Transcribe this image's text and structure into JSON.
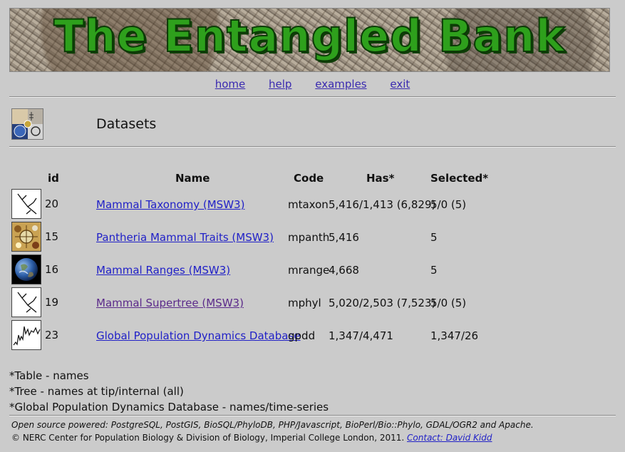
{
  "banner": {
    "title": "The Entangled Bank"
  },
  "nav": [
    "home",
    "help",
    "examples",
    "exit"
  ],
  "page": {
    "title": "Datasets"
  },
  "table": {
    "headers": {
      "id": "id",
      "name": "Name",
      "code": "Code",
      "has": "Has*",
      "selected": "Selected*"
    },
    "rows": [
      {
        "id": "20",
        "name": "Mammal Taxonomy (MSW3)",
        "code": "mtaxon",
        "has": "5,416/1,413 (6,829)",
        "selected": "5/0 (5)",
        "thumb": "tree-icon"
      },
      {
        "id": "15",
        "name": "Pantheria Mammal Traits (MSW3)",
        "code": "mpanth",
        "has": "5,416",
        "selected": "5",
        "thumb": "traits-icon"
      },
      {
        "id": "16",
        "name": "Mammal Ranges (MSW3)",
        "code": "mrange",
        "has": "4,668",
        "selected": "5",
        "thumb": "globe-icon"
      },
      {
        "id": "19",
        "name": "Mammal Supertree (MSW3)",
        "code": "mphyl",
        "has": "5,020/2,503 (7,523)",
        "selected": "5/0 (5)",
        "thumb": "tree-icon"
      },
      {
        "id": "23",
        "name": "Global Population Dynamics Database",
        "code": "gpdd",
        "has": "1,347/4,471",
        "selected": "1,347/26",
        "thumb": "timeseries-icon"
      }
    ]
  },
  "notes": [
    "*Table - names",
    "*Tree - names at tip/internal (all)",
    "*Global Population Dynamics Database - names/time-series"
  ],
  "footer": {
    "powered": "Open source powered: PostgreSQL, PostGIS, BioSQL/PhyloDB, PHP/Javascript, BioPerl/Bio::Phylo, GDAL/OGR2 and Apache.",
    "copyright": "© NERC Center for Population Biology & Division of Biology, Imperial College London, 2011.",
    "contact": "Contact: David Kidd"
  }
}
